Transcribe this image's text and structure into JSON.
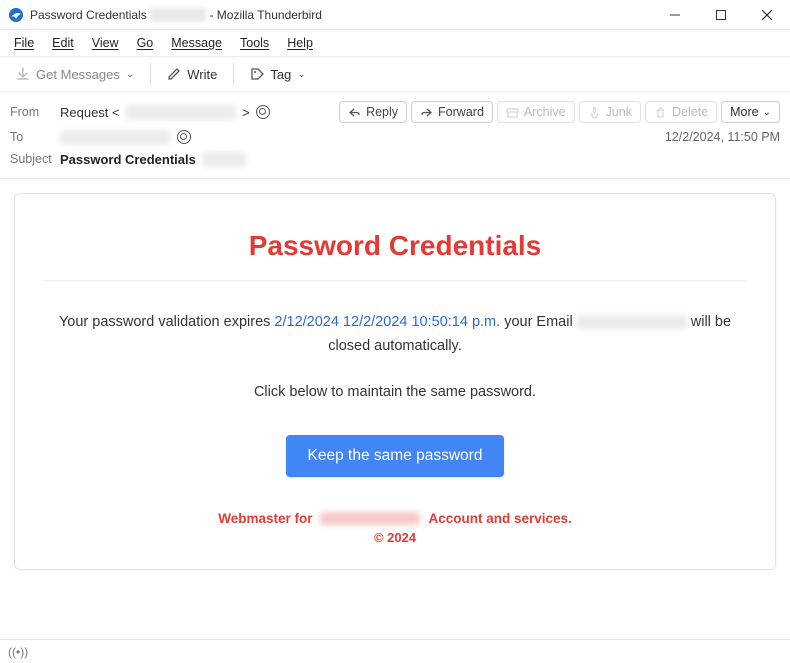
{
  "window": {
    "title_prefix": "Password Credentials",
    "title_redacted": "XXXXXXX",
    "title_suffix": " - Mozilla Thunderbird"
  },
  "menubar": {
    "file": "File",
    "edit": "Edit",
    "view": "View",
    "go": "Go",
    "message": "Message",
    "tools": "Tools",
    "help": "Help"
  },
  "toolbar": {
    "get_messages": "Get Messages",
    "write": "Write",
    "tag": "Tag"
  },
  "headers": {
    "from_label": "From",
    "from_name": "Request <",
    "from_redacted": "xxxxxxxxxxxxxxxxx",
    "from_close": ">",
    "to_label": "To",
    "to_redacted": "xxxxxxxxxxxxxxxxx",
    "subject_label": "Subject",
    "subject_value": "Password Credentials",
    "subject_redacted": "xxxxxxx",
    "datetime": "12/2/2024, 11:50 PM"
  },
  "actions": {
    "reply": "Reply",
    "forward": "Forward",
    "archive": "Archive",
    "junk": "Junk",
    "delete": "Delete",
    "more": "More"
  },
  "email": {
    "title": "Password Credentials",
    "body_pre": "Your password validation expires ",
    "body_link": "2/12/2024 12/2/2024 10:50:14 p.m.",
    "body_mid": " your Email ",
    "body_post": " will be closed automatically.",
    "body_line2": "Click below to maintain the same password.",
    "cta": "Keep the same password",
    "footer_pre": "Webmaster for",
    "footer_post": "Account and services.",
    "copyright": "© 2024"
  },
  "status": {
    "indicator": "((•))"
  }
}
